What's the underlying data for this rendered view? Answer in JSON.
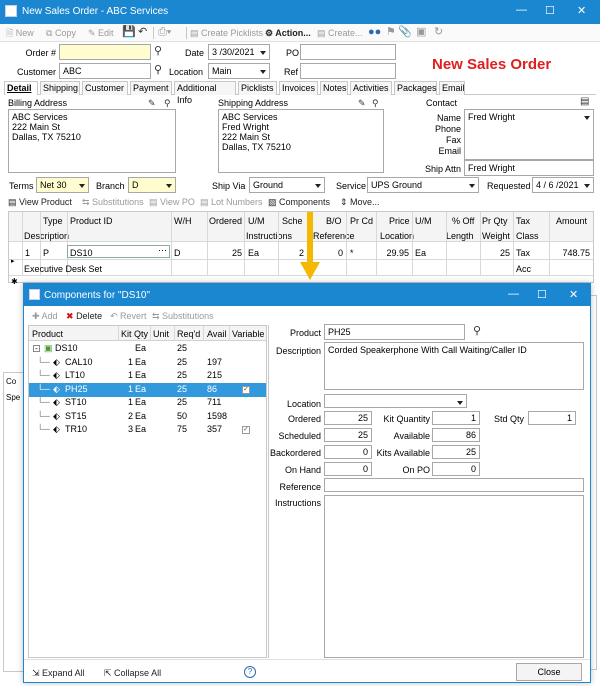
{
  "window": {
    "title": "New Sales Order - ABC Services",
    "heading": "New Sales Order"
  },
  "toolbar": {
    "new": "New",
    "copy": "Copy",
    "edit": "Edit",
    "create_picklists": "Create Picklists",
    "action": "Action...",
    "create": "Create..."
  },
  "header": {
    "order_label": "Order #",
    "order_value": "",
    "date_label": "Date",
    "date_value": "3 /30/2021",
    "po_label": "PO",
    "po_value": "",
    "customer_label": "Customer",
    "customer_value": "ABC",
    "location_label": "Location",
    "location_value": "Main",
    "ref_label": "Ref",
    "ref_value": ""
  },
  "tabs": [
    "Detail",
    "Shipping",
    "Customer",
    "Payment",
    "Additional Info",
    "Picklists",
    "Invoices",
    "Notes",
    "Activities",
    "Packages",
    "Email"
  ],
  "billing": {
    "label": "Billing Address",
    "text": "ABC Services\n222 Main St\nDallas, TX 75210"
  },
  "shipping": {
    "label": "Shipping Address",
    "text": "ABC Services\nFred Wright\n222 Main St\nDallas, TX 75210"
  },
  "contact": {
    "label": "Contact",
    "name_label": "Name",
    "name_value": "Fred Wright",
    "phone_label": "Phone",
    "fax_label": "Fax",
    "email_label": "Email",
    "ship_attn_label": "Ship Attn",
    "ship_attn_value": "Fred Wright"
  },
  "terms": {
    "terms_label": "Terms",
    "terms_value": "Net 30",
    "branch_label": "Branch",
    "branch_value": "D",
    "ship_via_label": "Ship Via",
    "ship_via_value": "Ground",
    "service_label": "Service",
    "service_value": "UPS Ground",
    "requested_label": "Requested",
    "requested_value": "4 / 6 /2021"
  },
  "lines_toolbar": {
    "view_product": "View Product",
    "substitutions": "Substitutions",
    "view_po": "View PO",
    "lot_numbers": "Lot Numbers",
    "components": "Components",
    "move": "Move..."
  },
  "grid": {
    "headers_top": [
      "Type",
      "Product ID",
      "W/H",
      "Ordered",
      "U/M",
      "Sche",
      "B/O",
      "Pr Cd",
      "Price",
      "U/M",
      "% Off",
      "Pr Qty",
      "Tax",
      "Amount"
    ],
    "headers_bottom": [
      "Description",
      "Instructions",
      "Reference",
      "Location",
      "Length",
      "Weight",
      "Class"
    ],
    "row": {
      "num": "1",
      "type": "P",
      "product_id": "DS10",
      "wh": "D",
      "ordered": "25",
      "um": "Ea",
      "sched": "2",
      "bo": "0",
      "prcd": "*",
      "price": "29.95",
      "um2": "Ea",
      "prqty": "25",
      "tax": "Tax",
      "amount": "748.75",
      "description": "Executive Desk Set",
      "class": "Acc"
    }
  },
  "dialog": {
    "title": "Components for \"DS10\"",
    "toolbar": {
      "add": "Add",
      "delete": "Delete",
      "revert": "Revert",
      "substitutions": "Substitutions"
    },
    "tree_headers": [
      "Product",
      "Kit Qty",
      "Unit",
      "Req'd",
      "Avail",
      "Variable"
    ],
    "tree_rows": [
      {
        "product": "DS10",
        "kitqty": "",
        "unit": "Ea",
        "reqd": "25",
        "avail": "",
        "variable": false,
        "root": true
      },
      {
        "product": "CAL10",
        "kitqty": "1",
        "unit": "Ea",
        "reqd": "25",
        "avail": "197",
        "variable": false
      },
      {
        "product": "LT10",
        "kitqty": "1",
        "unit": "Ea",
        "reqd": "25",
        "avail": "215",
        "variable": false
      },
      {
        "product": "PH25",
        "kitqty": "1",
        "unit": "Ea",
        "reqd": "25",
        "avail": "86",
        "variable": true,
        "selected": true
      },
      {
        "product": "ST10",
        "kitqty": "1",
        "unit": "Ea",
        "reqd": "25",
        "avail": "711",
        "variable": false
      },
      {
        "product": "ST15",
        "kitqty": "2",
        "unit": "Ea",
        "reqd": "50",
        "avail": "1598",
        "variable": false
      },
      {
        "product": "TR10",
        "kitqty": "3",
        "unit": "Ea",
        "reqd": "75",
        "avail": "357",
        "variable": true
      }
    ],
    "detail": {
      "product_label": "Product",
      "product_value": "PH25",
      "description_label": "Description",
      "description_value": "Corded Speakerphone With Call Waiting/Caller ID",
      "location_label": "Location",
      "ordered_label": "Ordered",
      "ordered_value": "25",
      "kit_qty_label": "Kit Quantity",
      "kit_qty_value": "1",
      "std_qty_label": "Std Qty",
      "std_qty_value": "1",
      "scheduled_label": "Scheduled",
      "scheduled_value": "25",
      "available_label": "Available",
      "available_value": "86",
      "backordered_label": "Backordered",
      "backordered_value": "0",
      "kits_available_label": "Kits Available",
      "kits_available_value": "25",
      "on_hand_label": "On Hand",
      "on_hand_value": "0",
      "on_po_label": "On PO",
      "on_po_value": "0",
      "reference_label": "Reference",
      "instructions_label": "Instructions"
    },
    "footer": {
      "expand": "Expand All",
      "collapse": "Collapse All",
      "close": "Close"
    }
  },
  "colors": {
    "titlebar": "#1a87d0",
    "selection": "#3399dd",
    "heading_red": "#e02020",
    "arrow": "#f5b800",
    "yellow_field": "#fffdd0"
  }
}
